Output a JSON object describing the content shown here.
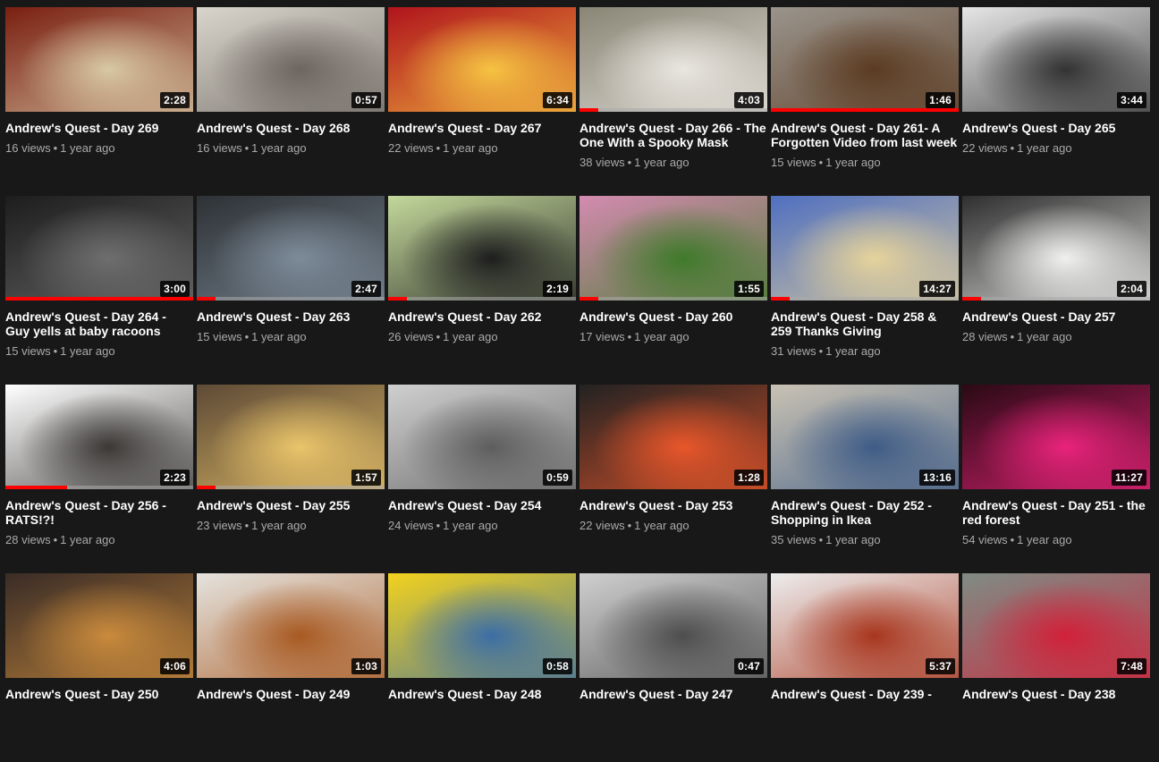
{
  "videos": [
    {
      "title": "Andrew's Quest - Day 269",
      "duration": "2:28",
      "views": "16 views",
      "age": "1 year ago",
      "watched": 0,
      "thumb_colors": [
        "#7a1f12",
        "#d8c8a4"
      ],
      "thumb_subject": "food-plate"
    },
    {
      "title": "Andrew's Quest - Day 268",
      "duration": "0:57",
      "views": "16 views",
      "age": "1 year ago",
      "watched": 0,
      "thumb_colors": [
        "#d9d5cc",
        "#6c6660"
      ],
      "thumb_subject": "stairs"
    },
    {
      "title": "Andrew's Quest - Day 267",
      "duration": "6:34",
      "views": "22 views",
      "age": "1 year ago",
      "watched": 0,
      "thumb_colors": [
        "#b0141c",
        "#f6c342"
      ],
      "thumb_subject": "cuphead-cartoon"
    },
    {
      "title": "Andrew's Quest - Day 266 - The One With a Spooky Mask",
      "duration": "4:03",
      "views": "38 views",
      "age": "1 year ago",
      "watched": 0.1,
      "thumb_colors": [
        "#8a8676",
        "#e9e6e0"
      ],
      "thumb_subject": "person-mask"
    },
    {
      "title": "Andrew's Quest - Day 261- A Forgotten Video from last week",
      "duration": "1:46",
      "views": "15 views",
      "age": "1 year ago",
      "watched": 1.0,
      "thumb_colors": [
        "#9a948c",
        "#5b3b22"
      ],
      "thumb_subject": "sandwich"
    },
    {
      "title": "Andrew's Quest - Day 265",
      "duration": "3:44",
      "views": "22 views",
      "age": "1 year ago",
      "watched": 0,
      "thumb_colors": [
        "#e6e6e6",
        "#333333"
      ],
      "thumb_subject": "metal-basket"
    },
    {
      "title": "Andrew's Quest - Day 264 - Guy yells at baby racoons",
      "duration": "3:00",
      "views": "15 views",
      "age": "1 year ago",
      "watched": 1.0,
      "thumb_colors": [
        "#1d1d1d",
        "#6e6e6e"
      ],
      "thumb_subject": "bike-sign"
    },
    {
      "title": "Andrew's Quest - Day 263",
      "duration": "2:47",
      "views": "15 views",
      "age": "1 year ago",
      "watched": 0.1,
      "thumb_colors": [
        "#2e3236",
        "#7d8b99"
      ],
      "thumb_subject": "game-character"
    },
    {
      "title": "Andrew's Quest - Day 262",
      "duration": "2:19",
      "views": "26 views",
      "age": "1 year ago",
      "watched": 0.1,
      "thumb_colors": [
        "#c3d89b",
        "#1e1e1e"
      ],
      "thumb_subject": "cabbage"
    },
    {
      "title": "Andrew's Quest - Day 260",
      "duration": "1:55",
      "views": "17 views",
      "age": "1 year ago",
      "watched": 0.1,
      "thumb_colors": [
        "#d48bb0",
        "#3f7a2a"
      ],
      "thumb_subject": "game-field"
    },
    {
      "title": "Andrew's Quest - Day 258 & 259 Thanks Giving",
      "duration": "14:27",
      "views": "31 views",
      "age": "1 year ago",
      "watched": 0.1,
      "thumb_colors": [
        "#4f6fc0",
        "#e6d39b"
      ],
      "thumb_subject": "dinner-plate"
    },
    {
      "title": "Andrew's Quest - Day 257",
      "duration": "2:04",
      "views": "28 views",
      "age": "1 year ago",
      "watched": 0.1,
      "thumb_colors": [
        "#2f2f2f",
        "#f0f0ee"
      ],
      "thumb_subject": "sushi"
    },
    {
      "title": "Andrew's Quest - Day 256 - RATS!?!",
      "duration": "2:23",
      "views": "28 views",
      "age": "1 year ago",
      "watched": 0.33,
      "thumb_colors": [
        "#ffffff",
        "#3b3836"
      ],
      "thumb_subject": "rat"
    },
    {
      "title": "Andrew's Quest - Day 255",
      "duration": "1:57",
      "views": "23 views",
      "age": "1 year ago",
      "watched": 0.1,
      "thumb_colors": [
        "#5e4a36",
        "#e9c46a"
      ],
      "thumb_subject": "fries"
    },
    {
      "title": "Andrew's Quest - Day 254",
      "duration": "0:59",
      "views": "24 views",
      "age": "1 year ago",
      "watched": 0,
      "thumb_colors": [
        "#cfcfcf",
        "#5e5e5e"
      ],
      "thumb_subject": "stairs"
    },
    {
      "title": "Andrew's Quest - Day 253",
      "duration": "1:28",
      "views": "22 views",
      "age": "1 year ago",
      "watched": 0,
      "thumb_colors": [
        "#222222",
        "#e8562a"
      ],
      "thumb_subject": "safety-vest"
    },
    {
      "title": "Andrew's Quest - Day 252 - Shopping in Ikea",
      "duration": "13:16",
      "views": "35 views",
      "age": "1 year ago",
      "watched": 0,
      "thumb_colors": [
        "#c9c2b3",
        "#3f5c86"
      ],
      "thumb_subject": "store-selfie"
    },
    {
      "title": "Andrew's Quest - Day 251 - the red forest",
      "duration": "11:27",
      "views": "54 views",
      "age": "1 year ago",
      "watched": 0,
      "thumb_colors": [
        "#2a0a14",
        "#e8237a"
      ],
      "thumb_subject": "red-lights"
    },
    {
      "title": "Andrew's Quest - Day 250",
      "duration": "4:06",
      "views": "",
      "age": "",
      "watched": 0,
      "thumb_colors": [
        "#3a2c26",
        "#c98a3c"
      ],
      "thumb_subject": "mooncakes"
    },
    {
      "title": "Andrew's Quest - Day 249",
      "duration": "1:03",
      "views": "",
      "age": "",
      "watched": 0,
      "thumb_colors": [
        "#e5e3de",
        "#a85a22"
      ],
      "thumb_subject": "spaghetti"
    },
    {
      "title": "Andrew's Quest - Day 248",
      "duration": "0:58",
      "views": "",
      "age": "",
      "watched": 0,
      "thumb_colors": [
        "#f2d21e",
        "#3c6ea6"
      ],
      "thumb_subject": "grocery-store"
    },
    {
      "title": "Andrew's Quest - Day 247",
      "duration": "0:47",
      "views": "",
      "age": "",
      "watched": 0,
      "thumb_colors": [
        "#cfcfcf",
        "#4e4e4e"
      ],
      "thumb_subject": "stairs"
    },
    {
      "title": "Andrew's Quest - Day 239 -",
      "duration": "5:37",
      "views": "",
      "age": "",
      "watched": 0,
      "thumb_colors": [
        "#ededed",
        "#a8361e"
      ],
      "thumb_subject": "chicken-broccoli"
    },
    {
      "title": "Andrew's Quest - Day 238",
      "duration": "7:48",
      "views": "",
      "age": "",
      "watched": 0,
      "thumb_colors": [
        "#7f8c84",
        "#d1213a"
      ],
      "thumb_subject": "arcade-entrance"
    }
  ]
}
